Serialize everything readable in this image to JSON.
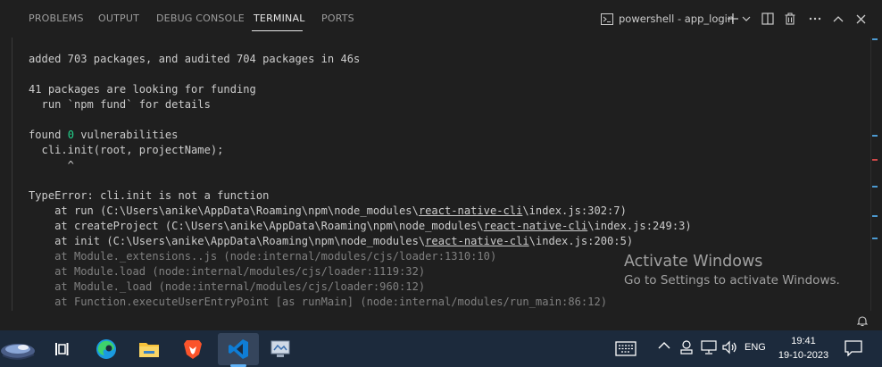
{
  "panel": {
    "tabs": [
      {
        "label": "PROBLEMS"
      },
      {
        "label": "OUTPUT"
      },
      {
        "label": "DEBUG CONSOLE"
      },
      {
        "label": "TERMINAL"
      },
      {
        "label": "PORTS"
      }
    ],
    "active_tab": "TERMINAL",
    "terminal_name": "powershell - app_login"
  },
  "terminal": {
    "line1": "added 703 packages, and audited 704 packages in 46s",
    "line3": "41 packages are looking for funding",
    "line4": "  run `npm fund` for details",
    "found_prefix": "found ",
    "found_count": "0",
    "found_suffix": " vulnerabilities",
    "line7": "  cli.init(root, projectName);",
    "line8": "      ^",
    "error": "TypeError: cli.init is not a function",
    "stack1_a": "    at run (C:\\Users\\anike\\AppData\\Roaming\\npm\\node_modules\\",
    "stack1_b": "react-native-cli",
    "stack1_c": "\\index.js:302:7)",
    "stack2_a": "    at createProject (C:\\Users\\anike\\AppData\\Roaming\\npm\\node_modules\\",
    "stack2_b": "react-native-cli",
    "stack2_c": "\\index.js:249:3)",
    "stack3_a": "    at init (C:\\Users\\anike\\AppData\\Roaming\\npm\\node_modules\\",
    "stack3_b": "react-native-cli",
    "stack3_c": "\\index.js:200:5)",
    "stack4": "    at Module._extensions..js (node:internal/modules/cjs/loader:1310:10)",
    "stack5": "    at Module.load (node:internal/modules/cjs/loader:1119:32)",
    "stack6": "    at Module._load (node:internal/modules/cjs/loader:960:12)",
    "stack7": "    at Function.executeUserEntryPoint [as runMain] (node:internal/modules/run_main:86:12)"
  },
  "watermark": {
    "title": "Activate Windows",
    "subtitle": "Go to Settings to activate Windows."
  },
  "taskbar": {
    "icons": [
      "task-view-icon",
      "edge-icon",
      "file-explorer-icon",
      "brave-icon",
      "vscode-icon",
      "app-icon"
    ],
    "language": "ENG",
    "time": "19:41",
    "date": "19-10-2023"
  },
  "colors": {
    "panel_bg": "#1f1f1f",
    "text": "#cccccc",
    "dim": "#808080",
    "green": "#23d18b",
    "taskbar_bg": "#1c2a3c",
    "vscode_blue": "#0f7dd5"
  }
}
